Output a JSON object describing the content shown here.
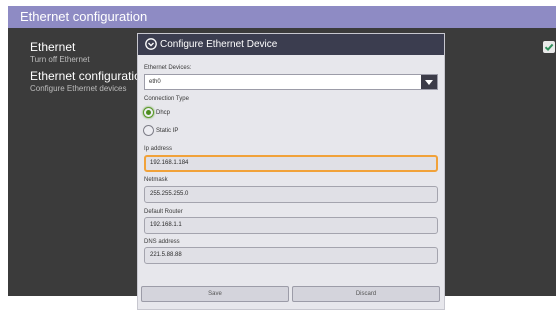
{
  "window": {
    "title": "Ethernet configuration"
  },
  "settings": {
    "items": [
      {
        "title": "Ethernet",
        "subtitle": "Turn off Ethernet"
      },
      {
        "title": "Ethernet configuration",
        "subtitle": "Configure Ethernet devices"
      }
    ],
    "ethernet_enabled": true
  },
  "dialog": {
    "title": "Configure Ethernet Device",
    "devices_label": "Ethernet Devices:",
    "device_value": "eth0",
    "connection_type_label": "Connection Type",
    "options": [
      {
        "label": "Dhcp",
        "selected": true
      },
      {
        "label": "Static IP",
        "selected": false
      }
    ],
    "ip_label": "Ip address",
    "ip_value": "192.168.1.184",
    "netmask_label": "Netmask",
    "netmask_value": "255.255.255.0",
    "router_label": "Default Router",
    "router_value": "192.168.1.1",
    "dns_label": "DNS address",
    "dns_value": "221.5.88.88",
    "save_label": "Save",
    "discard_label": "Discard"
  },
  "colors": {
    "titlebar": "#8e8bc4",
    "focus": "#f1a23a",
    "radio_on": "#4c8c1e",
    "dialog_header": "#3b3d4f"
  }
}
